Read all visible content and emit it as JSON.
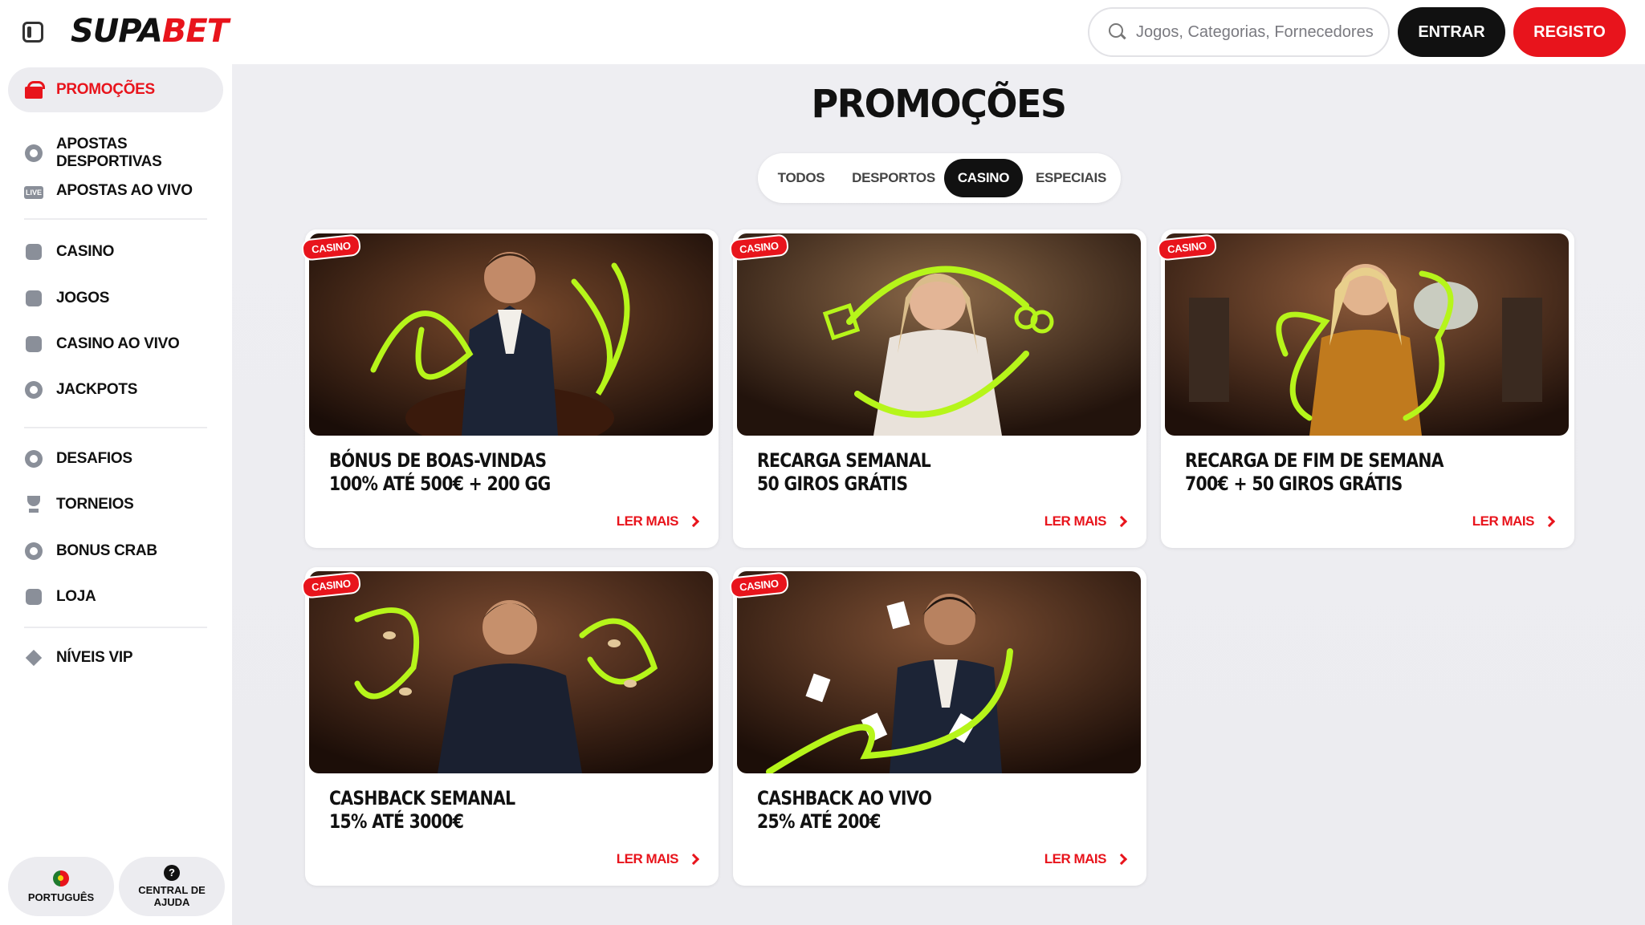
{
  "header": {
    "logo_part1": "SUPA",
    "logo_part2": "BET",
    "search_placeholder": "Jogos, Categorias, Fornecedores",
    "login_label": "ENTRAR",
    "register_label": "REGISTO"
  },
  "sidebar": {
    "items": [
      {
        "label": "PROMOÇÕES",
        "icon": "gift-icon",
        "active": true
      },
      {
        "label": "APOSTAS DESPORTIVAS",
        "icon": "soccer-ball-icon"
      },
      {
        "label": "APOSTAS AO VIVO",
        "icon": "live-icon"
      },
      {
        "label": "CASINO",
        "icon": "slot-777-icon"
      },
      {
        "label": "JOGOS",
        "icon": "slot-machine-icon"
      },
      {
        "label": "CASINO AO VIVO",
        "icon": "playing-card-icon"
      },
      {
        "label": "JACKPOTS",
        "icon": "clover-icon"
      },
      {
        "label": "DESAFIOS",
        "icon": "challenge-badge-icon"
      },
      {
        "label": "TORNEIOS",
        "icon": "trophy-icon"
      },
      {
        "label": "BONUS CRAB",
        "icon": "crab-icon"
      },
      {
        "label": "LOJA",
        "icon": "shopping-bag-icon"
      },
      {
        "label": "NÍVEIS VIP",
        "icon": "diamond-icon"
      }
    ],
    "language_label": "PORTUGUÊS",
    "help_label": "CENTRAL DE AJUDA",
    "help_glyph": "?"
  },
  "main": {
    "title": "PROMOÇÕES",
    "tabs": [
      {
        "label": "TODOS",
        "active": false
      },
      {
        "label": "DESPORTOS",
        "active": false
      },
      {
        "label": "CASINO",
        "active": true
      },
      {
        "label": "ESPECIAIS",
        "active": false
      }
    ],
    "read_more_label": "LER MAIS",
    "cards": [
      {
        "badge": "CASINO",
        "line1": "BÓNUS DE BOAS-VINDAS",
        "line2": "100% ATÉ 500€ + 200 GG"
      },
      {
        "badge": "CASINO",
        "line1": "RECARGA SEMANAL",
        "line2": "50 GIROS GRÁTIS"
      },
      {
        "badge": "CASINO",
        "line1": "RECARGA DE FIM DE SEMANA",
        "line2": "700€ + 50 GIROS GRÁTIS"
      },
      {
        "badge": "CASINO",
        "line1": "CASHBACK SEMANAL",
        "line2": "15% ATÉ 3000€"
      },
      {
        "badge": "CASINO",
        "line1": "CASHBACK AO VIVO",
        "line2": "25% ATÉ 200€"
      }
    ]
  },
  "colors": {
    "brand_red": "#e8141c",
    "dark": "#111111",
    "accent_lime": "#b6f51a"
  }
}
